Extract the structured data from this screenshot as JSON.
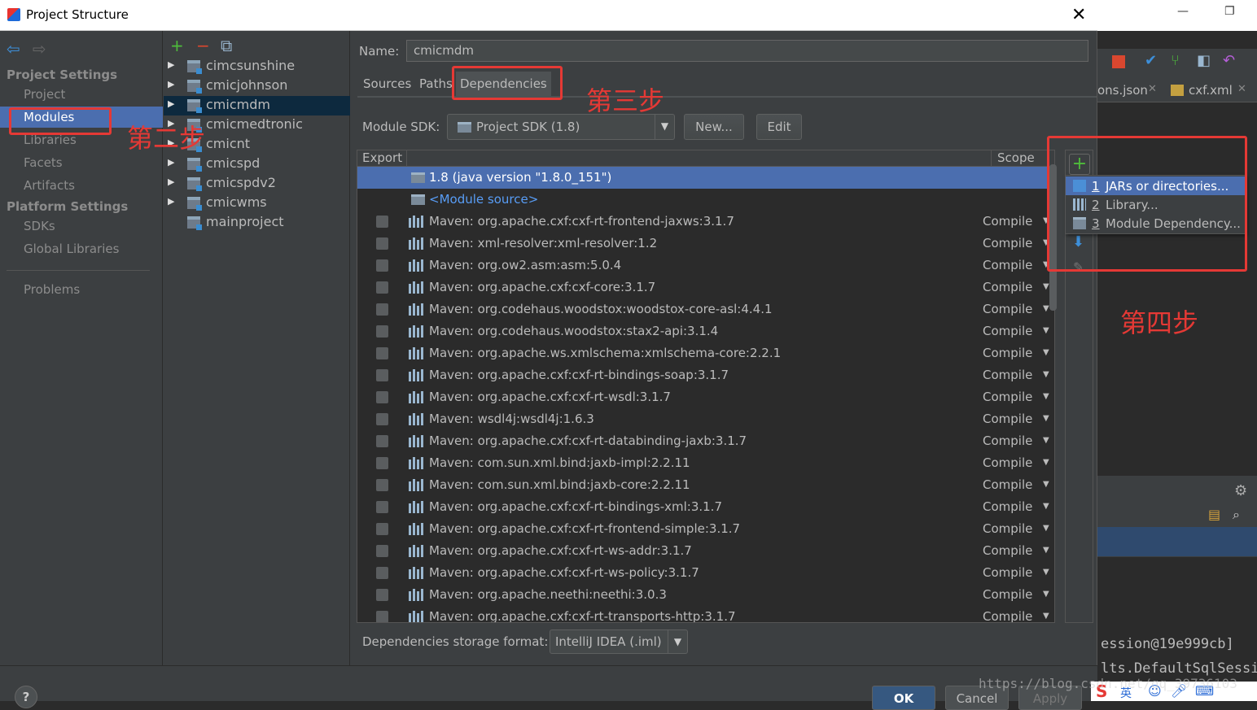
{
  "dialog": {
    "title": "Project Structure",
    "close": "✕"
  },
  "nav": {
    "project_settings": "Project Settings",
    "items_ps": [
      "Project",
      "Modules",
      "Libraries",
      "Facets",
      "Artifacts"
    ],
    "platform_settings": "Platform Settings",
    "items_pl": [
      "SDKs",
      "Global Libraries"
    ],
    "problems": "Problems"
  },
  "tree": {
    "toolbar": [
      "+",
      "−",
      "⧉"
    ],
    "modules": [
      "cimcsunshine",
      "cmicjohnson",
      "cmicmdm",
      "cmicmedtronic",
      "cmicnt",
      "cmicspd",
      "cmicspdv2",
      "cmicwms",
      "mainproject"
    ]
  },
  "main": {
    "name_label": "Name:",
    "name_value": "cmicmdm",
    "tabs": [
      "Sources",
      "Paths",
      "Dependencies"
    ],
    "sdk_label": "Module SDK:",
    "sdk_value": "Project SDK (1.8)",
    "new_btn": "New...",
    "edit_btn": "Edit",
    "col_export": "Export",
    "col_scope": "Scope",
    "sdk_row": "1.8 (java version \"1.8.0_151\")",
    "module_source": "<Module source>",
    "deps": [
      "Maven: org.apache.cxf:cxf-rt-frontend-jaxws:3.1.7",
      "Maven: xml-resolver:xml-resolver:1.2",
      "Maven: org.ow2.asm:asm:5.0.4",
      "Maven: org.apache.cxf:cxf-core:3.1.7",
      "Maven: org.codehaus.woodstox:woodstox-core-asl:4.4.1",
      "Maven: org.codehaus.woodstox:stax2-api:3.1.4",
      "Maven: org.apache.ws.xmlschema:xmlschema-core:2.2.1",
      "Maven: org.apache.cxf:cxf-rt-bindings-soap:3.1.7",
      "Maven: org.apache.cxf:cxf-rt-wsdl:3.1.7",
      "Maven: wsdl4j:wsdl4j:1.6.3",
      "Maven: org.apache.cxf:cxf-rt-databinding-jaxb:3.1.7",
      "Maven: com.sun.xml.bind:jaxb-impl:2.2.11",
      "Maven: com.sun.xml.bind:jaxb-core:2.2.11",
      "Maven: org.apache.cxf:cxf-rt-bindings-xml:3.1.7",
      "Maven: org.apache.cxf:cxf-rt-frontend-simple:3.1.7",
      "Maven: org.apache.cxf:cxf-rt-ws-addr:3.1.7",
      "Maven: org.apache.cxf:cxf-rt-ws-policy:3.1.7",
      "Maven: org.apache.neethi:neethi:3.0.3",
      "Maven: org.apache.cxf:cxf-rt-transports-http:3.1.7"
    ],
    "scope_value": "Compile",
    "storage_label": "Dependencies storage format:",
    "storage_value": "IntelliJ IDEA (.iml)"
  },
  "popup": {
    "items": [
      {
        "num": "1",
        "label": "JARs or directories..."
      },
      {
        "num": "2",
        "label": "Library..."
      },
      {
        "num": "3",
        "label": "Module Dependency..."
      }
    ]
  },
  "bottom": {
    "help": "?",
    "ok": "OK",
    "cancel": "Cancel",
    "apply": "Apply"
  },
  "annotations": {
    "step2": "第二步",
    "step3": "第三步",
    "step4": "第四步"
  },
  "background": {
    "tab1": "ons.json",
    "tab2": "cxf.xml",
    "console1": "ession@19e999cb]",
    "console2": "lts.DefaultSqlSessio",
    "watermark": "https://blog.csdn.net/qq_39736103"
  },
  "colors": {
    "selection": "#4b6eaf",
    "annotation": "#e53935",
    "panel": "#3c3f41",
    "editor": "#2b2b2b"
  }
}
